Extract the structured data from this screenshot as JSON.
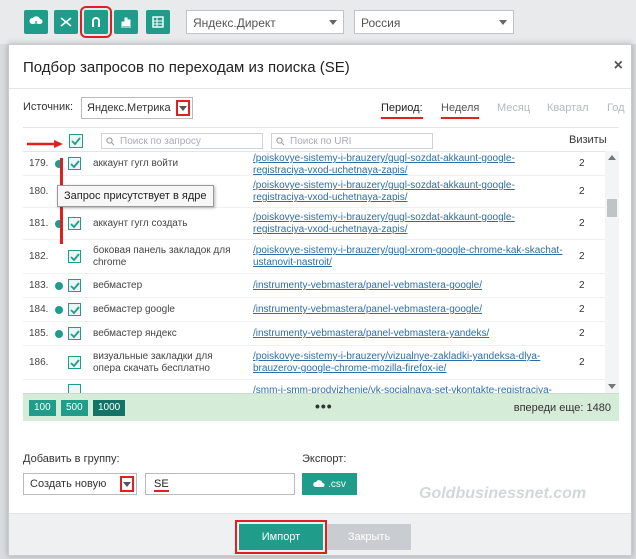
{
  "toolbar": {
    "icons": [
      "cloud-download-icon",
      "shuffle-icon",
      "magnet-icon",
      "bar-chart-icon",
      "table-icon"
    ],
    "platform_select": "Яндекс.Директ",
    "region_select": "Россия"
  },
  "modal": {
    "title": "Подбор запросов по переходам из поиска (SE)",
    "close": "×",
    "source_label": "Источник:",
    "source_value": "Яндекс.Метрика",
    "period_label": "Период:",
    "periods": [
      "Неделя",
      "Месяц",
      "Квартал",
      "Год"
    ],
    "search_query_placeholder": "Поиск по запросу",
    "search_uri_placeholder": "Поиск по URI",
    "visits_header": "Визиты",
    "tooltip": "Запрос присутствует в ядре",
    "rows": [
      {
        "num": "179.",
        "query": "аккаунт гугл войти",
        "uri": "/poiskovye-sistemy-i-brauzery/gugl-sozdat-akkaunt-google-registraciya-vxod-uchetnaya-zapis/",
        "visits": "2"
      },
      {
        "num": "180.",
        "query": "",
        "uri": "/poiskovye-sistemy-i-brauzery/gugl-sozdat-akkaunt-google-registraciya-vxod-uchetnaya-zapis/",
        "visits": "2"
      },
      {
        "num": "181.",
        "query": "аккаунт гугл создать",
        "uri": "/poiskovye-sistemy-i-brauzery/gugl-sozdat-akkaunt-google-registraciya-vxod-uchetnaya-zapis/",
        "visits": "2"
      },
      {
        "num": "182.",
        "query": "боковая панель закладок для chrome",
        "uri": "/poiskovye-sistemy-i-brauzery/gugl-xrom-google-chrome-kak-skachat-ustanovit-nastroit/",
        "visits": "2"
      },
      {
        "num": "183.",
        "query": "вебмастер",
        "uri": "/instrumenty-vebmastera/panel-vebmastera-google/",
        "visits": "2"
      },
      {
        "num": "184.",
        "query": "вебмастер google",
        "uri": "/instrumenty-vebmastera/panel-vebmastera-google/",
        "visits": "2"
      },
      {
        "num": "185.",
        "query": "вебмастер яндекс",
        "uri": "/instrumenty-vebmastera/panel-vebmastera-yandeks/",
        "visits": "2"
      },
      {
        "num": "186.",
        "query": "визуальные закладки для опера скачать бесплатно",
        "uri": "/poiskovye-sistemy-i-brauzery/vizualnye-zakladki-yandeksa-dlya-brauzerov-google-chrome-mozilla-firefox-ie/",
        "visits": "2"
      },
      {
        "num": "",
        "query": "",
        "uri": "/smm-i-smm-prodvizhenie/vk-socialnaya-set-vkontakte-registraciya-vxod",
        "visits": ""
      }
    ],
    "page_sizes": [
      "100",
      "500",
      "1000"
    ],
    "more": "•••",
    "ahead": "впереди еще: 1480",
    "group_label": "Добавить в группу:",
    "group_value": "Создать новую",
    "group_name": "SE",
    "export_label": "Экспорт:",
    "csv_label": ".csv",
    "watermark": "Goldbusinessnet.com",
    "import_btn": "Импорт",
    "close_btn": "Закрыть"
  }
}
